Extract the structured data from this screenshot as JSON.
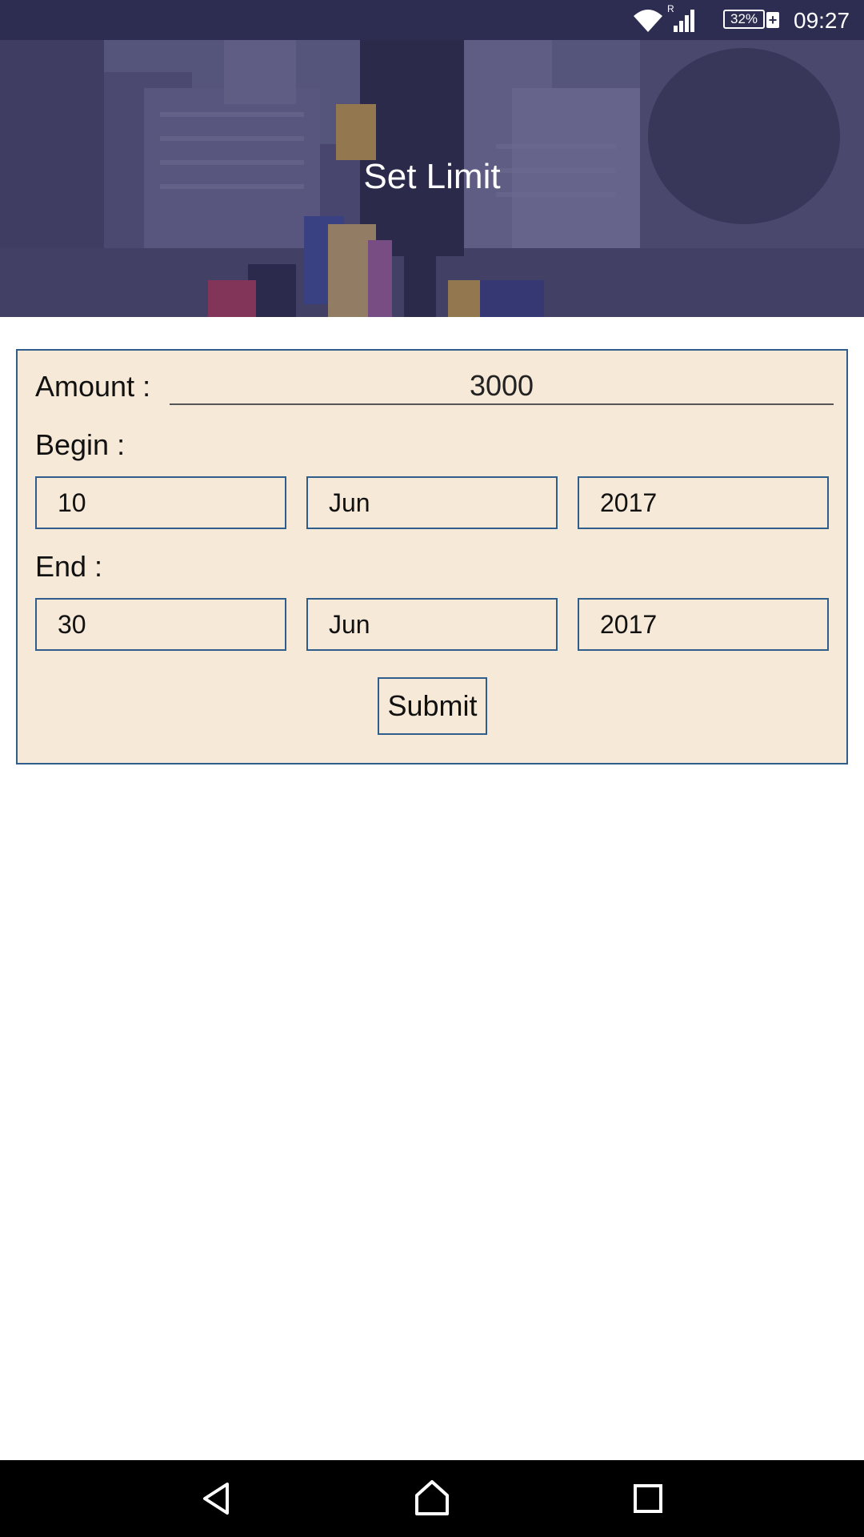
{
  "status_bar": {
    "time": "09:27",
    "battery_percent": "32%",
    "battery_plus": "+",
    "roaming_indicator": "R",
    "icons": [
      "wifi-icon",
      "cell-signal-icon",
      "battery-icon"
    ]
  },
  "header": {
    "title": "Set Limit"
  },
  "form": {
    "amount_label": "Amount :",
    "amount_value": "3000",
    "begin_label": "Begin :",
    "begin": {
      "day": "10",
      "month": "Jun",
      "year": "2017"
    },
    "end_label": "End :",
    "end": {
      "day": "30",
      "month": "Jun",
      "year": "2017"
    },
    "submit_label": "Submit"
  },
  "nav_bar": {
    "icons": [
      "back-icon",
      "home-icon",
      "recents-icon"
    ]
  },
  "colors": {
    "status_bar": "#2d2d52",
    "card_background": "#f7e9d7",
    "border_accent": "#2f5d8c"
  }
}
